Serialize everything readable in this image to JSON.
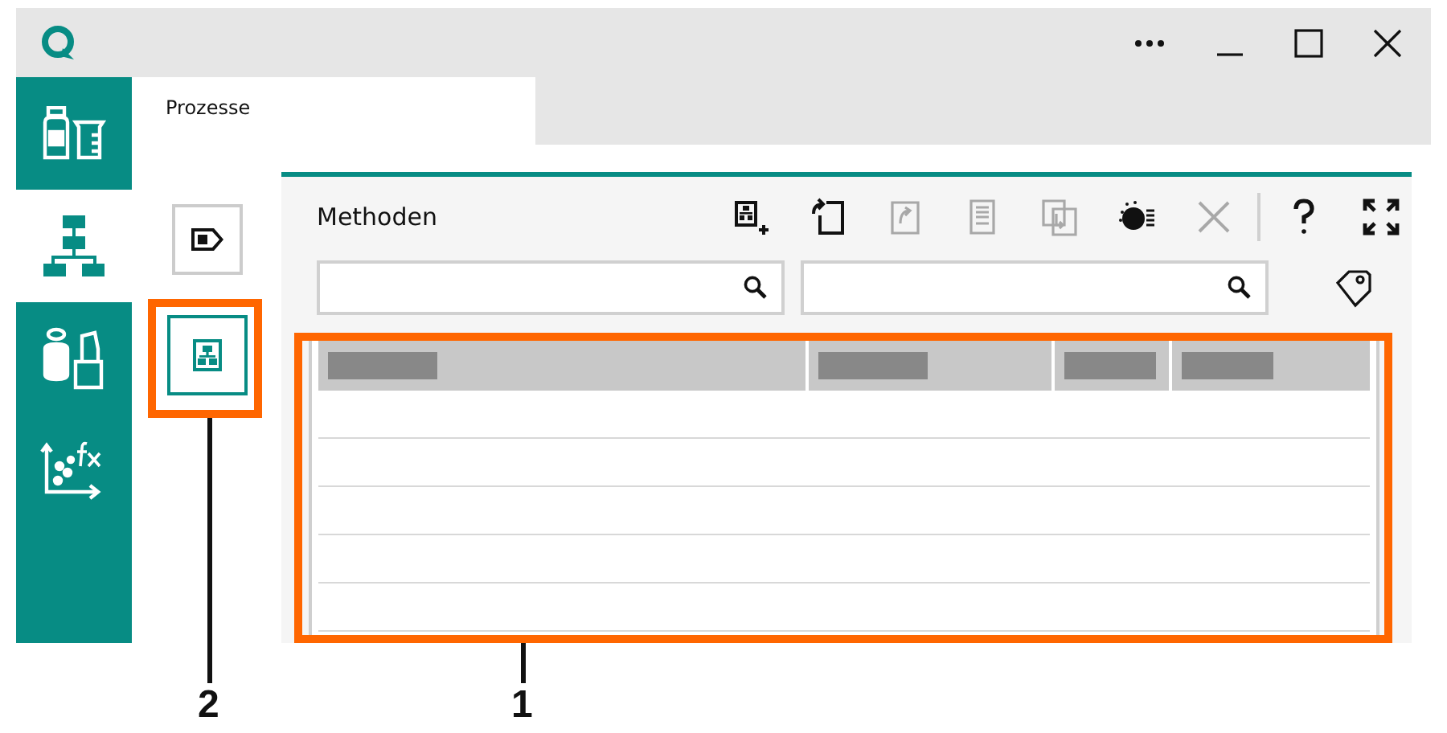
{
  "window": {
    "controls": [
      {
        "kind": "more"
      },
      {
        "kind": "minimize"
      },
      {
        "kind": "maximize"
      },
      {
        "kind": "close"
      }
    ]
  },
  "sidebar": {
    "items": [
      {
        "kind": "bottles",
        "selected": false
      },
      {
        "kind": "hierarchy",
        "selected": true
      },
      {
        "kind": "samples",
        "selected": false
      },
      {
        "kind": "function",
        "selected": false
      }
    ]
  },
  "tabs": [
    {
      "label": "Prozesse",
      "selected": true
    }
  ],
  "subnav": {
    "callout": "2",
    "items": [
      {
        "kind": "tag",
        "selected": false
      },
      {
        "kind": "method",
        "selected": true
      }
    ]
  },
  "panel": {
    "title": "Methoden",
    "toolbar": [
      {
        "kind": "add-method",
        "disabled": false
      },
      {
        "kind": "rotate-doc",
        "disabled": false
      },
      {
        "kind": "doc-arrow",
        "disabled": true
      },
      {
        "kind": "document",
        "disabled": true
      },
      {
        "kind": "transfer",
        "disabled": true
      },
      {
        "kind": "dial",
        "disabled": false
      },
      {
        "kind": "delete",
        "disabled": true
      },
      {
        "kind": "separator"
      },
      {
        "kind": "help",
        "disabled": false
      },
      {
        "kind": "expand",
        "disabled": false
      }
    ],
    "search_fields": [
      {
        "disabled": false
      },
      {
        "disabled": false
      }
    ],
    "table": {
      "callout": "1",
      "columns": [
        {
          "redacted": true
        },
        {
          "redacted": true
        },
        {
          "redacted": true
        },
        {
          "redacted": true
        }
      ],
      "rows": [
        {
          "selected": false
        },
        {
          "selected": false
        },
        {
          "selected": false
        },
        {
          "selected": false
        },
        {
          "selected": false
        }
      ]
    }
  }
}
